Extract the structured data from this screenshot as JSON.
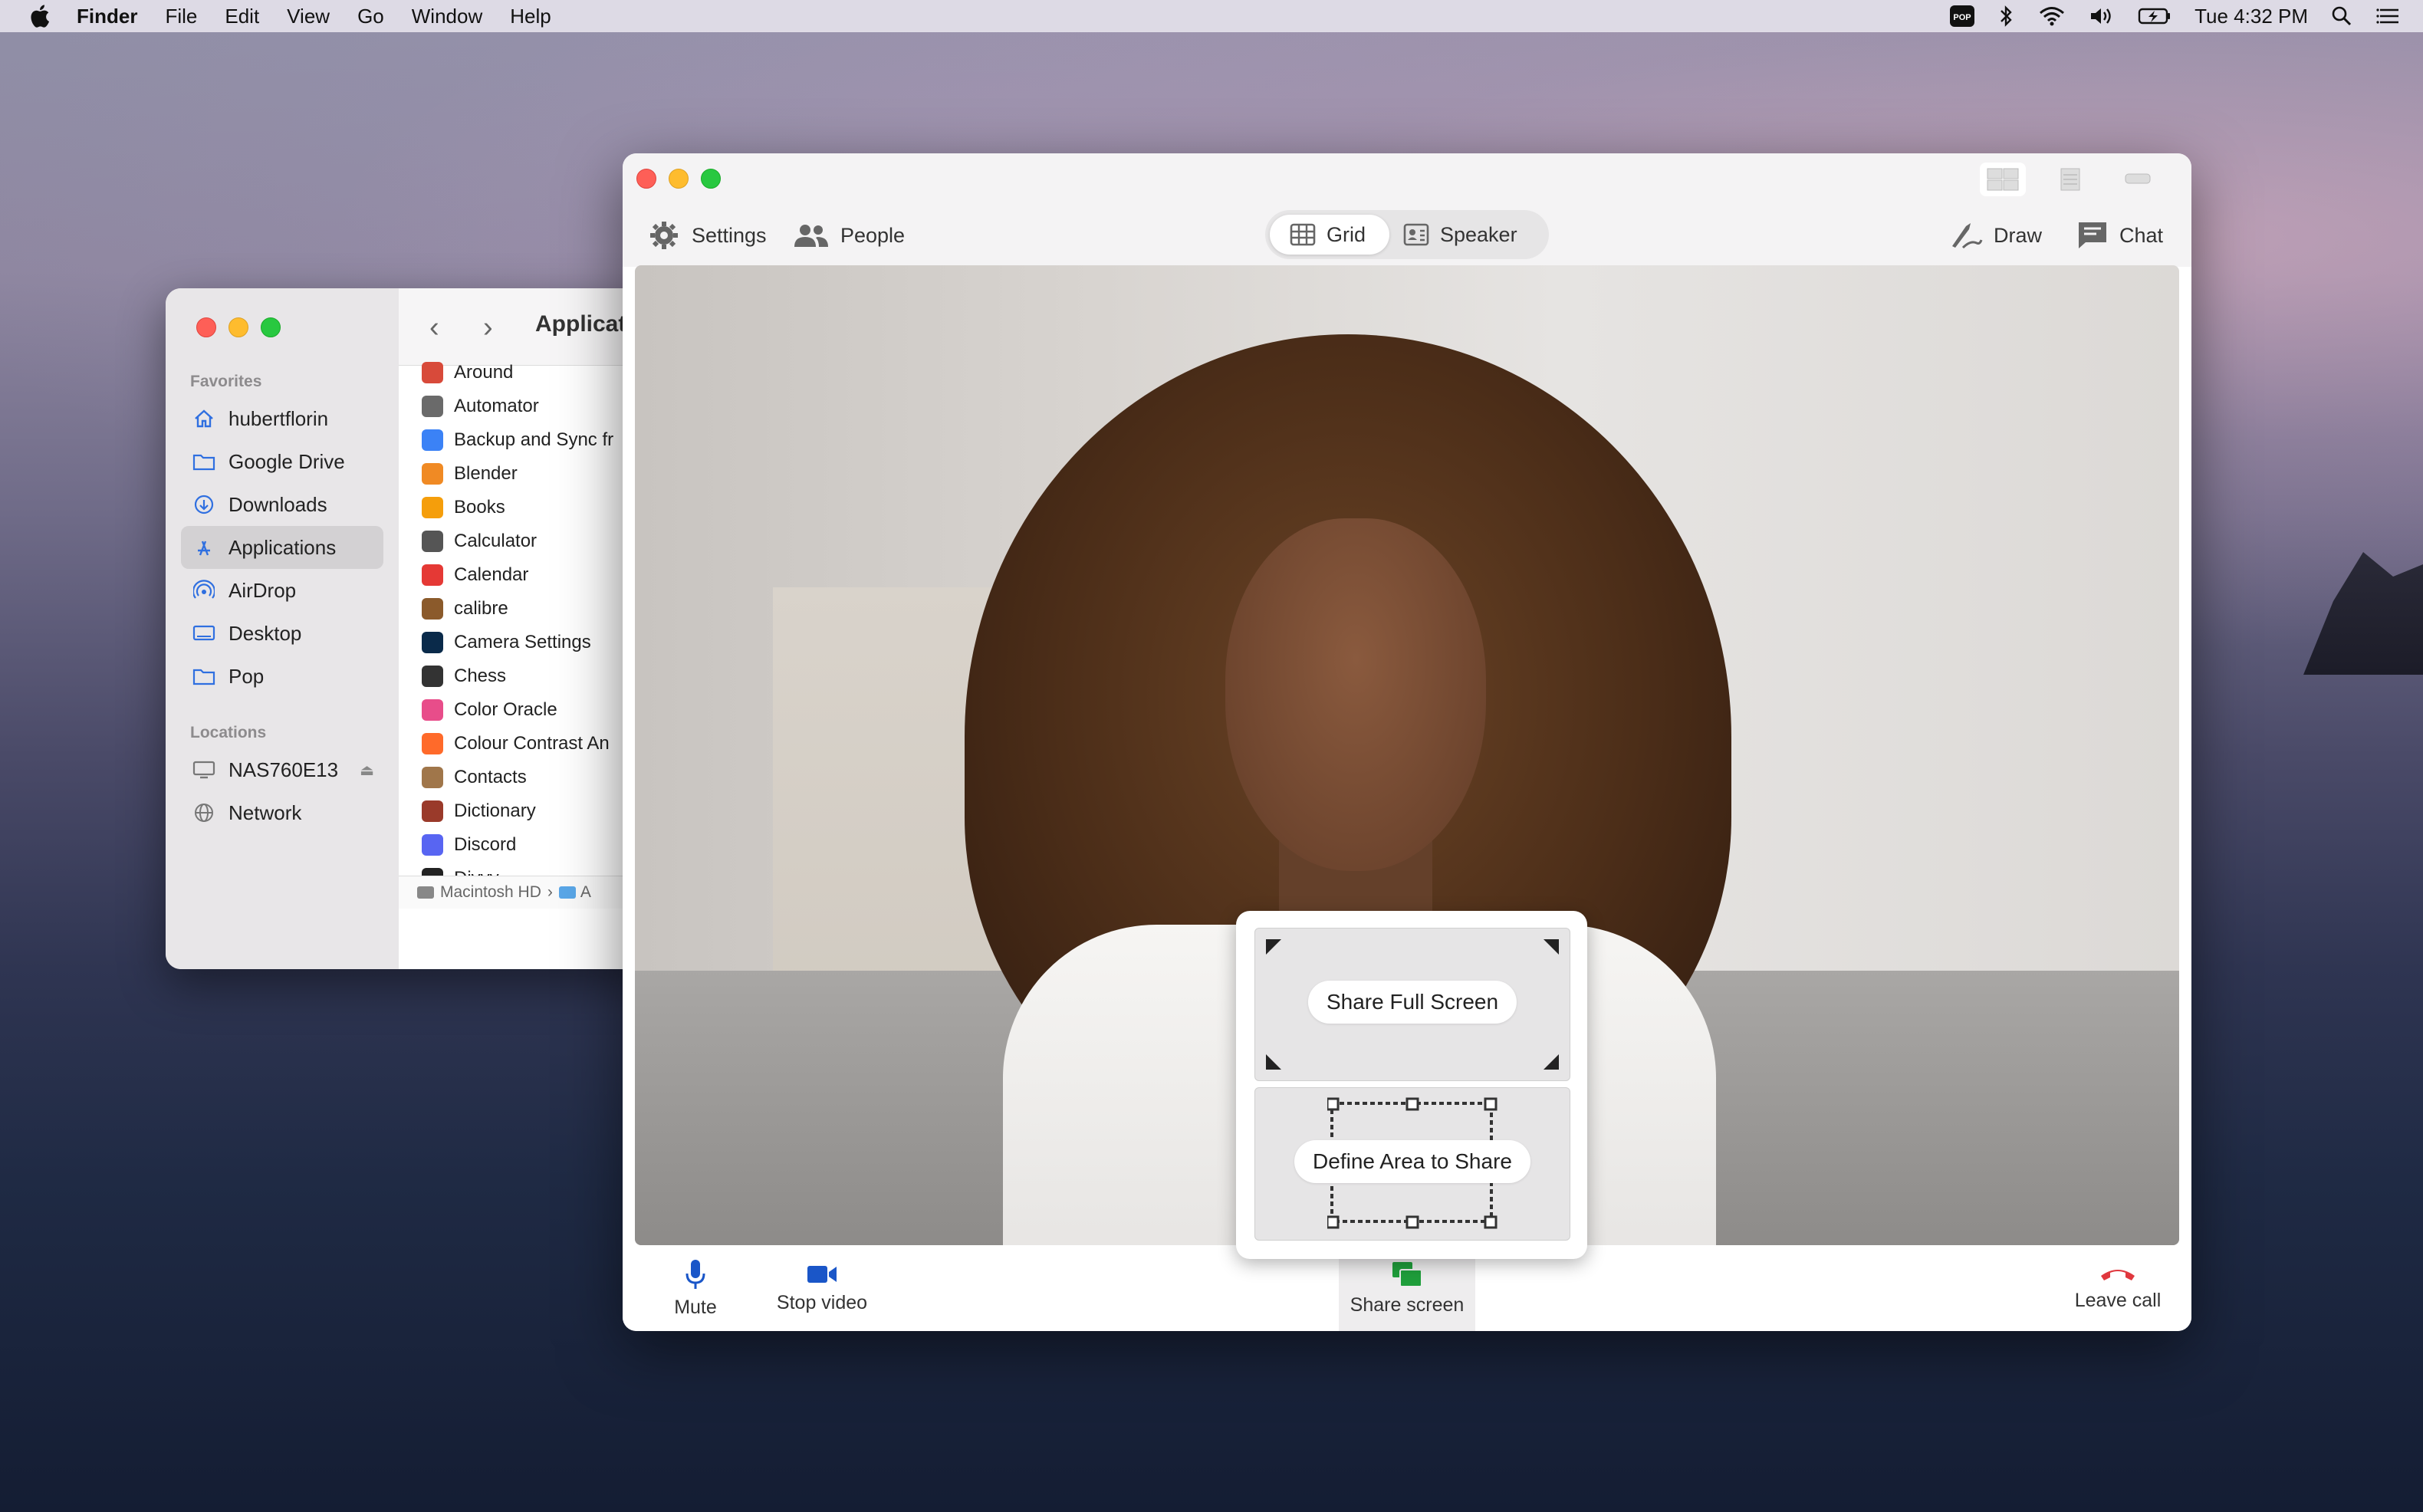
{
  "menubar": {
    "app_name": "Finder",
    "menus": [
      "File",
      "Edit",
      "View",
      "Go",
      "Window",
      "Help"
    ],
    "clock": "Tue 4:32 PM",
    "status_icons": [
      "pop-icon",
      "bluetooth-icon",
      "wifi-icon",
      "volume-icon",
      "battery-icon",
      "spotlight-icon",
      "control-center-icon"
    ]
  },
  "finder": {
    "title": "Applicat",
    "sidebar": {
      "favorites_heading": "Favorites",
      "favorites": [
        {
          "label": "hubertflorin",
          "icon": "home-icon"
        },
        {
          "label": "Google Drive",
          "icon": "folder-icon"
        },
        {
          "label": "Downloads",
          "icon": "downloads-icon"
        },
        {
          "label": "Applications",
          "icon": "applications-icon"
        },
        {
          "label": "AirDrop",
          "icon": "airdrop-icon"
        },
        {
          "label": "Desktop",
          "icon": "desktop-icon"
        },
        {
          "label": "Pop",
          "icon": "folder-icon"
        }
      ],
      "locations_heading": "Locations",
      "locations": [
        {
          "label": "NAS760E13",
          "icon": "computer-icon"
        },
        {
          "label": "Network",
          "icon": "network-icon"
        }
      ]
    },
    "files": [
      "Around",
      "Automator",
      "Backup and Sync fr",
      "Blender",
      "Books",
      "Calculator",
      "Calendar",
      "calibre",
      "Camera Settings",
      "Chess",
      "Color Oracle",
      "Colour Contrast An",
      "Contacts",
      "Dictionary",
      "Discord",
      "Divvy"
    ],
    "file_colors": [
      "#d84a3a",
      "#6a6a6a",
      "#3b82f6",
      "#f08a24",
      "#f59e0b",
      "#555555",
      "#e53935",
      "#8b5a2b",
      "#0a2a4a",
      "#333333",
      "#e84d8a",
      "#ff6a2a",
      "#a0764a",
      "#9a3a2a",
      "#5865f2",
      "#222222"
    ],
    "pathbar": {
      "disk": "Macintosh HD",
      "separator": "›",
      "next": "A"
    }
  },
  "call": {
    "toolbar": {
      "settings": "Settings",
      "people": "People",
      "grid": "Grid",
      "speaker": "Speaker",
      "draw": "Draw",
      "chat": "Chat"
    },
    "share_popup": {
      "full_screen": "Share Full Screen",
      "define_area": "Define Area to Share"
    },
    "bottom": {
      "mute": "Mute",
      "stop_video": "Stop video",
      "share_screen": "Share screen",
      "leave_call": "Leave call"
    },
    "colors": {
      "accent_blue": "#1a56c8",
      "share_green": "#1f9e3b",
      "leave_red": "#e0383e"
    }
  }
}
